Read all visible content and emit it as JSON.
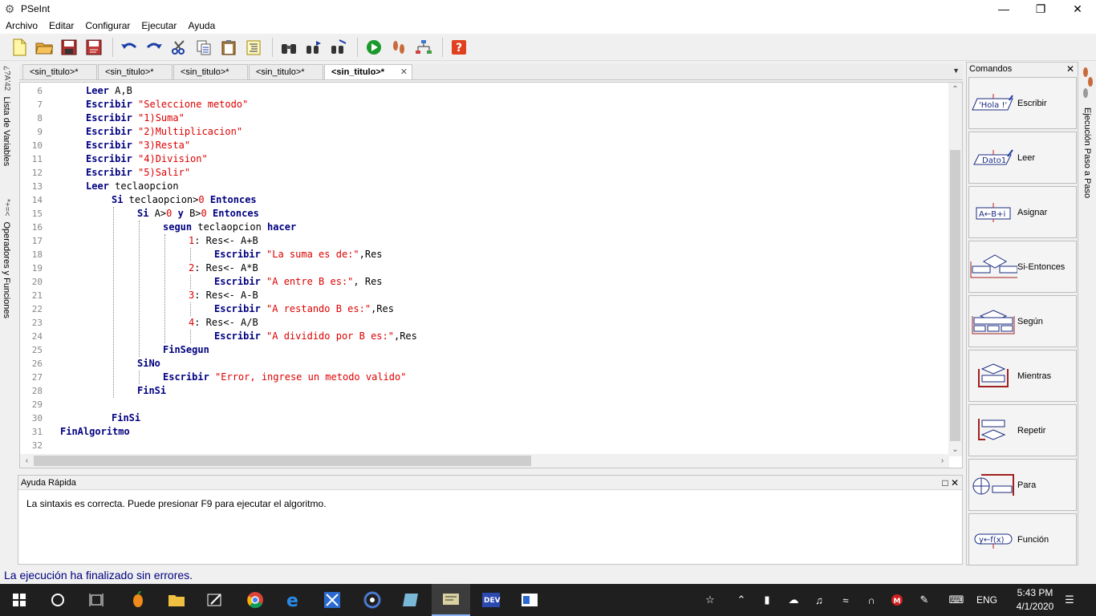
{
  "window": {
    "title": "PSeInt"
  },
  "menu": [
    "Archivo",
    "Editar",
    "Configurar",
    "Ejecutar",
    "Ayuda"
  ],
  "tabs": [
    {
      "label": "<sin_titulo>*",
      "active": false
    },
    {
      "label": "<sin_titulo>*",
      "active": false
    },
    {
      "label": "<sin_titulo>*",
      "active": false
    },
    {
      "label": "<sin_titulo>*",
      "active": false
    },
    {
      "label": "<sin_titulo>*",
      "active": true
    }
  ],
  "left_tabs": {
    "variables": "Lista de Variables",
    "operators": "Operadores y Funciones",
    "variables_icon": "*+=<",
    "operators_icon": "¿?A'42"
  },
  "code_lines": [
    {
      "n": "6",
      "indent": 1,
      "tokens": [
        [
          "kw",
          "Leer"
        ],
        [
          "t",
          " A,B"
        ]
      ]
    },
    {
      "n": "7",
      "indent": 1,
      "tokens": [
        [
          "kw",
          "Escribir"
        ],
        [
          "t",
          " "
        ],
        [
          "str",
          "\"Seleccione metodo\""
        ]
      ]
    },
    {
      "n": "8",
      "indent": 1,
      "tokens": [
        [
          "kw",
          "Escribir"
        ],
        [
          "t",
          " "
        ],
        [
          "str",
          "\"1)Suma\""
        ]
      ]
    },
    {
      "n": "9",
      "indent": 1,
      "tokens": [
        [
          "kw",
          "Escribir"
        ],
        [
          "t",
          " "
        ],
        [
          "str",
          "\"2)Multiplicacion\""
        ]
      ]
    },
    {
      "n": "10",
      "indent": 1,
      "tokens": [
        [
          "kw",
          "Escribir"
        ],
        [
          "t",
          " "
        ],
        [
          "str",
          "\"3)Resta\""
        ]
      ]
    },
    {
      "n": "11",
      "indent": 1,
      "tokens": [
        [
          "kw",
          "Escribir"
        ],
        [
          "t",
          " "
        ],
        [
          "str",
          "\"4)Division\""
        ]
      ]
    },
    {
      "n": "12",
      "indent": 1,
      "tokens": [
        [
          "kw",
          "Escribir"
        ],
        [
          "t",
          " "
        ],
        [
          "str",
          "\"5)Salir\""
        ]
      ]
    },
    {
      "n": "13",
      "indent": 1,
      "tokens": [
        [
          "kw",
          "Leer"
        ],
        [
          "t",
          " teclaopcion"
        ]
      ]
    },
    {
      "n": "14",
      "indent": 2,
      "tokens": [
        [
          "kw",
          "Si"
        ],
        [
          "t",
          " teclaopcion>"
        ],
        [
          "num",
          "0"
        ],
        [
          "t",
          " "
        ],
        [
          "kw",
          "Entonces"
        ]
      ]
    },
    {
      "n": "15",
      "indent": 3,
      "tokens": [
        [
          "kw",
          "Si"
        ],
        [
          "t",
          " A>"
        ],
        [
          "num",
          "0"
        ],
        [
          "t",
          " "
        ],
        [
          "kw",
          "y"
        ],
        [
          "t",
          " B>"
        ],
        [
          "num",
          "0"
        ],
        [
          "t",
          " "
        ],
        [
          "kw",
          "Entonces"
        ]
      ]
    },
    {
      "n": "16",
      "indent": 4,
      "tokens": [
        [
          "kw",
          "segun"
        ],
        [
          "t",
          " teclaopcion "
        ],
        [
          "kw",
          "hacer"
        ]
      ]
    },
    {
      "n": "17",
      "indent": 5,
      "tokens": [
        [
          "num",
          "1"
        ],
        [
          "t",
          ": Res<- A+B"
        ]
      ]
    },
    {
      "n": "18",
      "indent": 6,
      "tokens": [
        [
          "kw",
          "Escribir"
        ],
        [
          "t",
          " "
        ],
        [
          "str",
          "\"La suma es de:\""
        ],
        [
          "t",
          ",Res"
        ]
      ]
    },
    {
      "n": "19",
      "indent": 5,
      "tokens": [
        [
          "num",
          "2"
        ],
        [
          "t",
          ": Res<- A*B"
        ]
      ]
    },
    {
      "n": "20",
      "indent": 6,
      "tokens": [
        [
          "kw",
          "Escribir"
        ],
        [
          "t",
          " "
        ],
        [
          "str",
          "\"A entre B es:\""
        ],
        [
          "t",
          ", Res"
        ]
      ]
    },
    {
      "n": "21",
      "indent": 5,
      "tokens": [
        [
          "num",
          "3"
        ],
        [
          "t",
          ": Res<- A-B"
        ]
      ]
    },
    {
      "n": "22",
      "indent": 6,
      "tokens": [
        [
          "kw",
          "Escribir"
        ],
        [
          "t",
          " "
        ],
        [
          "str",
          "\"A restando B es:\""
        ],
        [
          "t",
          ",Res"
        ]
      ]
    },
    {
      "n": "23",
      "indent": 5,
      "tokens": [
        [
          "num",
          "4"
        ],
        [
          "t",
          ": Res<- A/B"
        ]
      ]
    },
    {
      "n": "24",
      "indent": 6,
      "tokens": [
        [
          "kw",
          "Escribir"
        ],
        [
          "t",
          " "
        ],
        [
          "str",
          "\"A dividido por B es:\""
        ],
        [
          "t",
          ",Res"
        ]
      ]
    },
    {
      "n": "25",
      "indent": 4,
      "tokens": [
        [
          "kw",
          "FinSegun"
        ]
      ]
    },
    {
      "n": "26",
      "indent": 3,
      "tokens": [
        [
          "kw",
          "SiNo"
        ]
      ]
    },
    {
      "n": "27",
      "indent": 4,
      "tokens": [
        [
          "kw",
          "Escribir"
        ],
        [
          "t",
          " "
        ],
        [
          "str",
          "\"Error, ingrese un metodo valido\""
        ]
      ]
    },
    {
      "n": "28",
      "indent": 3,
      "tokens": [
        [
          "kw",
          "FinSi"
        ]
      ]
    },
    {
      "n": "29",
      "indent": 0,
      "tokens": []
    },
    {
      "n": "30",
      "indent": 2,
      "tokens": [
        [
          "kw",
          "FinSi"
        ]
      ]
    },
    {
      "n": "31",
      "indent": 0,
      "tokens": [
        [
          "kw",
          "FinAlgoritmo"
        ]
      ]
    },
    {
      "n": "32",
      "indent": 0,
      "tokens": []
    }
  ],
  "help": {
    "title": "Ayuda Rápida",
    "message": "La sintaxis es correcta. Puede presionar F9 para ejecutar el algoritmo."
  },
  "commands": {
    "title": "Comandos",
    "items": [
      {
        "label": "Escribir",
        "icon_text": "'Hola !'"
      },
      {
        "label": "Leer",
        "icon_text": "Dato1"
      },
      {
        "label": "Asignar",
        "icon_text": "A←B+i"
      },
      {
        "label": "Si-Entonces",
        "icon_text": ""
      },
      {
        "label": "Según",
        "icon_text": ""
      },
      {
        "label": "Mientras",
        "icon_text": ""
      },
      {
        "label": "Repetir",
        "icon_text": ""
      },
      {
        "label": "Para",
        "icon_text": ""
      },
      {
        "label": "Función",
        "icon_text": "y←f(x)"
      }
    ]
  },
  "right_tab": "Ejecución Paso a Paso",
  "status": "La ejecución ha finalizado sin errores.",
  "taskbar": {
    "time": "5:43 PM",
    "date": "4/1/2020",
    "lang": "ENG"
  },
  "colors": {
    "keyword": "#000080",
    "string": "#dd0000",
    "status": "#000080"
  }
}
